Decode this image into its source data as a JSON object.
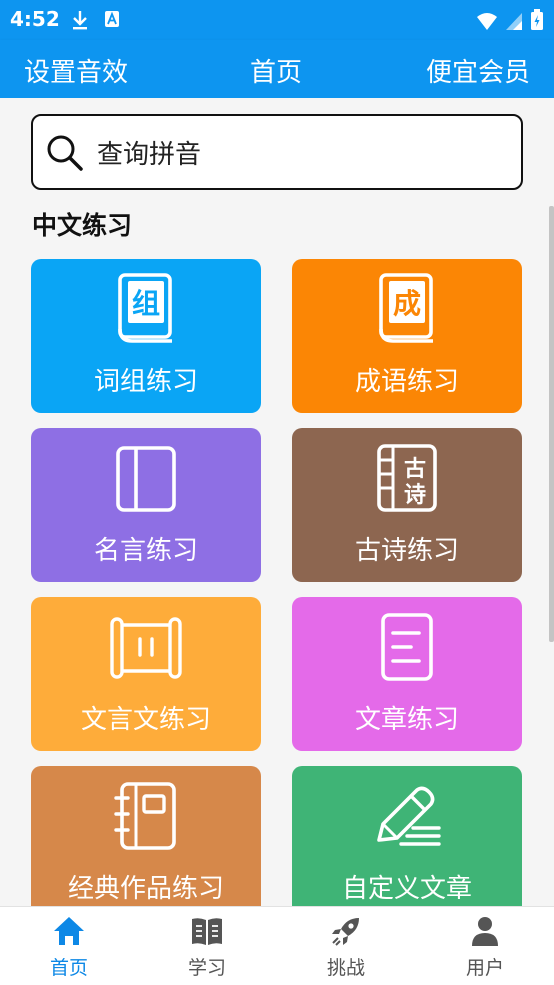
{
  "status_bar": {
    "time": "4:52"
  },
  "header": {
    "left_label": "设置音效",
    "title": "首页",
    "right_label": "便宜会员"
  },
  "search": {
    "placeholder": "查询拼音"
  },
  "section": {
    "title": "中文练习"
  },
  "cards": [
    {
      "label": "词组练习",
      "icon_char": "组",
      "icon": "book-icon",
      "color": "#0aa5f5"
    },
    {
      "label": "成语练习",
      "icon_char": "成",
      "icon": "book-icon",
      "color": "#fb8605"
    },
    {
      "label": "名言练习",
      "icon": "panel-book-icon",
      "color": "#8e6fe4"
    },
    {
      "label": "古诗练习",
      "icon_char": "古",
      "icon_char2": "诗",
      "icon": "classic-book-icon",
      "color": "#8d6650"
    },
    {
      "label": "文言文练习",
      "icon": "scroll-icon",
      "color": "#feac3a"
    },
    {
      "label": "文章练习",
      "icon": "document-icon",
      "color": "#e46ae9"
    },
    {
      "label": "经典作品练习",
      "icon": "notebook-icon",
      "color": "#d6884a"
    },
    {
      "label": "自定义文章",
      "icon": "pencil-icon",
      "color": "#3fb476"
    }
  ],
  "tabbar": {
    "tabs": [
      {
        "label": "首页",
        "icon": "home-icon",
        "active": true
      },
      {
        "label": "学习",
        "icon": "open-book-icon",
        "active": false
      },
      {
        "label": "挑战",
        "icon": "rocket-icon",
        "active": false
      },
      {
        "label": "用户",
        "icon": "user-icon",
        "active": false
      }
    ],
    "active_color": "#0d88e6",
    "inactive_color": "#555555"
  },
  "colors": {
    "brand": "#0d95f0"
  }
}
